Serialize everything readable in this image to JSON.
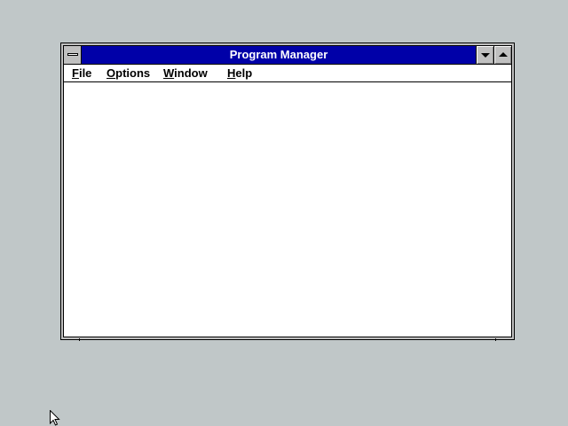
{
  "window": {
    "title": "Program Manager",
    "controls": {
      "system_menu_icon": "system-menu-icon",
      "minimize_icon": "triangle-down-icon",
      "maximize_icon": "triangle-up-icon"
    }
  },
  "menubar": {
    "items": [
      {
        "mnemonic": "F",
        "rest": "ile"
      },
      {
        "mnemonic": "O",
        "rest": "ptions"
      },
      {
        "mnemonic": "W",
        "rest": "indow"
      },
      {
        "mnemonic": "H",
        "rest": "elp"
      }
    ]
  },
  "colors": {
    "desktop": "#c0c7c8",
    "titlebar": "#0000a8",
    "title_text": "#ffffff",
    "client": "#ffffff"
  },
  "pointer": {
    "icon": "mouse-pointer-icon"
  }
}
